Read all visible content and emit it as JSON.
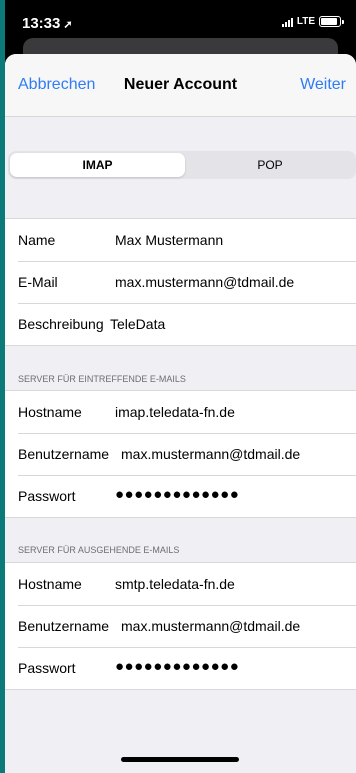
{
  "status": {
    "time": "13:33",
    "location_glyph": "➚",
    "network": "LTE"
  },
  "nav": {
    "cancel": "Abbrechen",
    "title": "Neuer Account",
    "next": "Weiter"
  },
  "segment": {
    "options": [
      "IMAP",
      "POP"
    ],
    "selected": "IMAP"
  },
  "account": {
    "rows": [
      {
        "label": "Name",
        "value": "Max Mustermann"
      },
      {
        "label": "E-Mail",
        "value": "max.mustermann@tdmail.de"
      },
      {
        "label": "Beschreibung",
        "value": "TeleData"
      }
    ]
  },
  "incoming": {
    "header": "SERVER FÜR EINTREFFENDE E-MAILS",
    "rows": [
      {
        "label": "Hostname",
        "value": "imap.teledata-fn.de"
      },
      {
        "label": "Benutzername",
        "value": "max.mustermann@tdmail.de"
      },
      {
        "label": "Passwort",
        "value": "●●●●●●●●●●●●●"
      }
    ]
  },
  "outgoing": {
    "header": "SERVER FÜR AUSGEHENDE E-MAILS",
    "rows": [
      {
        "label": "Hostname",
        "value": "smtp.teledata-fn.de"
      },
      {
        "label": "Benutzername",
        "value": "max.mustermann@tdmail.de"
      },
      {
        "label": "Passwort",
        "value": "●●●●●●●●●●●●●"
      }
    ]
  }
}
